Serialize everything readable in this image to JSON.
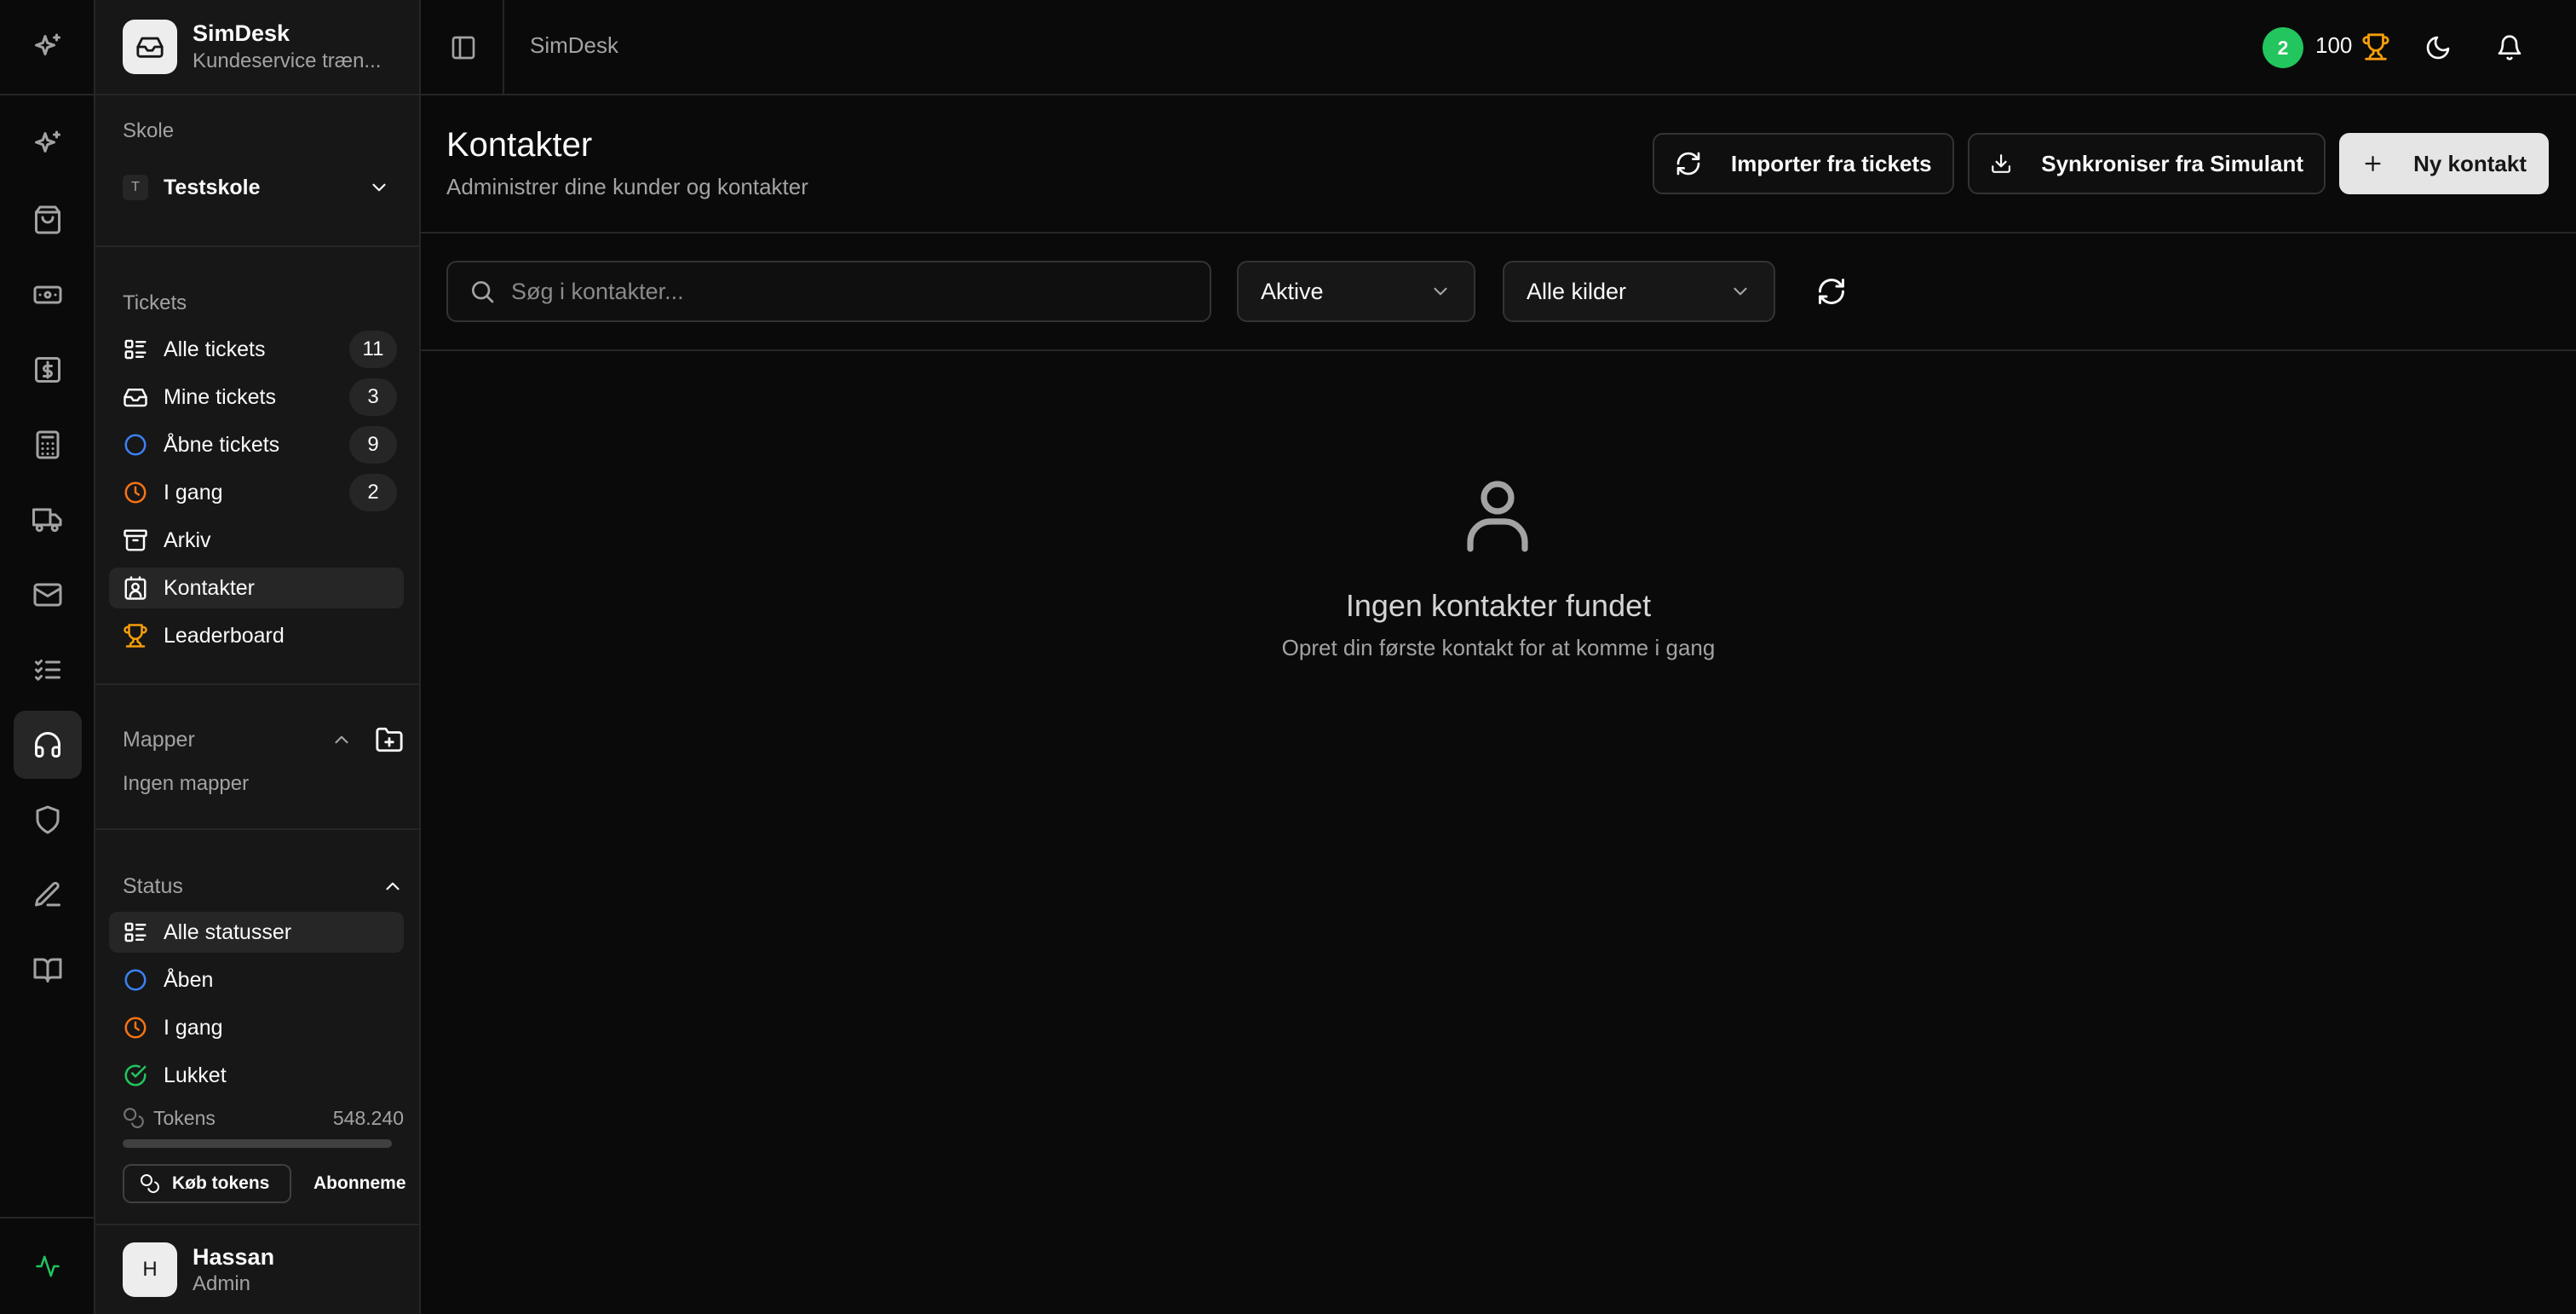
{
  "app": {
    "name": "SimDesk",
    "subtitle": "Kundeservice træn..."
  },
  "sidebar": {
    "school_section_label": "Skole",
    "school": {
      "badge": "T",
      "name": "Testskole"
    },
    "tickets_section_label": "Tickets",
    "nav_items": [
      {
        "label": "Alle tickets",
        "count": "11",
        "icon": "list-icon"
      },
      {
        "label": "Mine tickets",
        "count": "3",
        "icon": "inbox-icon"
      },
      {
        "label": "Åbne tickets",
        "count": "9",
        "icon": "circle-icon"
      },
      {
        "label": "I gang",
        "count": "2",
        "icon": "clock-icon"
      },
      {
        "label": "Arkiv",
        "count": "",
        "icon": "archive-icon"
      },
      {
        "label": "Kontakter",
        "count": "",
        "icon": "contact-icon"
      },
      {
        "label": "Leaderboard",
        "count": "",
        "icon": "trophy-icon"
      }
    ],
    "folders": {
      "label": "Mapper",
      "empty": "Ingen mapper"
    },
    "status": {
      "label": "Status",
      "items": [
        {
          "label": "Alle statusser",
          "icon": "list-icon"
        },
        {
          "label": "Åben",
          "icon": "circle-icon"
        },
        {
          "label": "I gang",
          "icon": "clock-icon"
        },
        {
          "label": "Lukket",
          "icon": "check-circle-icon"
        }
      ]
    },
    "tokens": {
      "label": "Tokens",
      "value": "548.240",
      "usage_fraction": 0.0
    },
    "buy_tokens_label": "Køb tokens",
    "subscription_label": "Abonneme",
    "user": {
      "initial": "H",
      "name": "Hassan",
      "role": "Admin"
    }
  },
  "topbar": {
    "breadcrumb": "SimDesk",
    "level": "2",
    "points": "100"
  },
  "page": {
    "title": "Kontakter",
    "subtitle": "Administrer dine kunder og kontakter",
    "actions": {
      "import": "Importer fra tickets",
      "sync": "Synkroniser fra Simulant",
      "new": "Ny kontakt"
    },
    "search_placeholder": "Søg i kontakter...",
    "filter_status": "Aktive",
    "filter_source": "Alle kilder",
    "empty_title": "Ingen kontakter fundet",
    "empty_subtitle": "Opret din første kontakt for at komme i gang"
  },
  "colors": {
    "background": "#0a0a0a",
    "sidebar": "#171717",
    "level_badge": "#22c55e",
    "trophy": "#f59e0b",
    "open_status": "#3b82f6",
    "in_progress_status": "#f97316",
    "closed_status": "#22c55e"
  }
}
